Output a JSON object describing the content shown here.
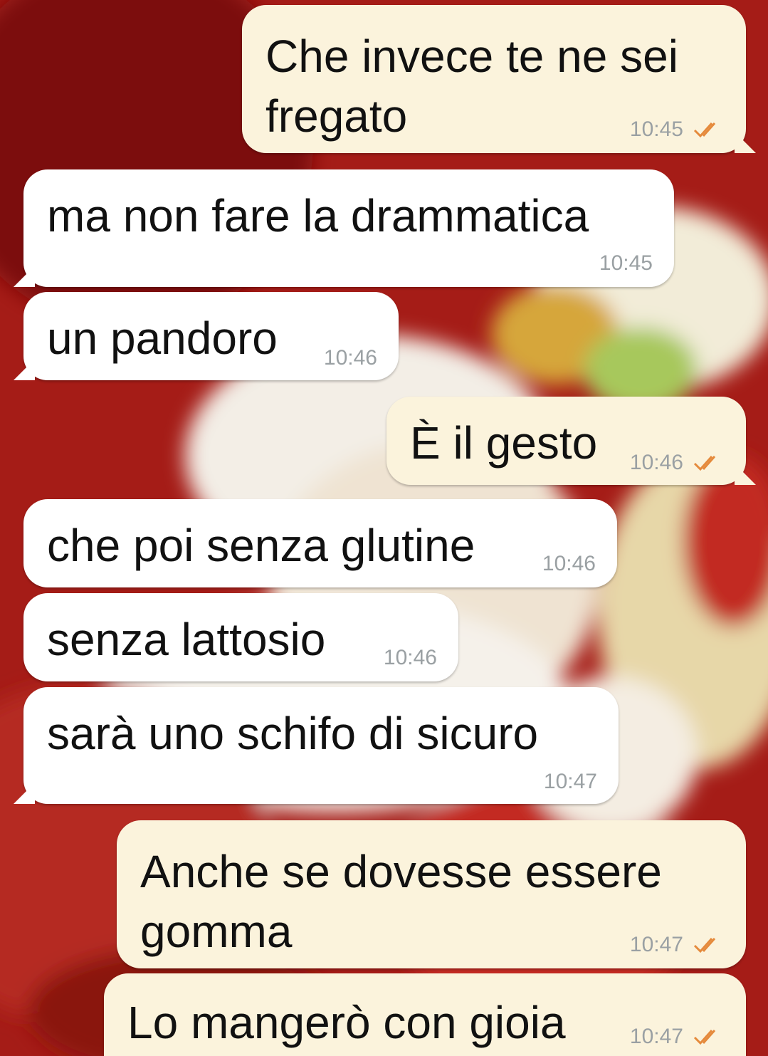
{
  "chat": {
    "messages": [
      {
        "text": "Che invece te ne sei\nfregato",
        "time": "10:45",
        "dir": "out",
        "status": "read-double-check-icon"
      },
      {
        "text": "ma non fare la drammatica",
        "time": "10:45",
        "dir": "in"
      },
      {
        "text": "un pandoro",
        "time": "10:46",
        "dir": "in"
      },
      {
        "text": "È il gesto",
        "time": "10:46",
        "dir": "out",
        "status": "read-double-check-icon"
      },
      {
        "text": "che poi senza glutine",
        "time": "10:46",
        "dir": "in"
      },
      {
        "text": "senza lattosio",
        "time": "10:46",
        "dir": "in"
      },
      {
        "text": "sarà uno schifo di sicuro",
        "time": "10:47",
        "dir": "in"
      },
      {
        "text": "Anche se dovesse essere\ngomma",
        "time": "10:47",
        "dir": "out",
        "status": "read-double-check-icon"
      },
      {
        "text": "Lo mangerò con gioia",
        "time": "10:47",
        "dir": "out",
        "status": "read-double-check-icon"
      }
    ]
  },
  "colors": {
    "incoming_bubble": "#ffffff",
    "outgoing_bubble": "#fbf3dc",
    "tick": "#e58a3c",
    "timestamp": "#9aa0a3",
    "wallpaper_red": "#9e1a15"
  }
}
